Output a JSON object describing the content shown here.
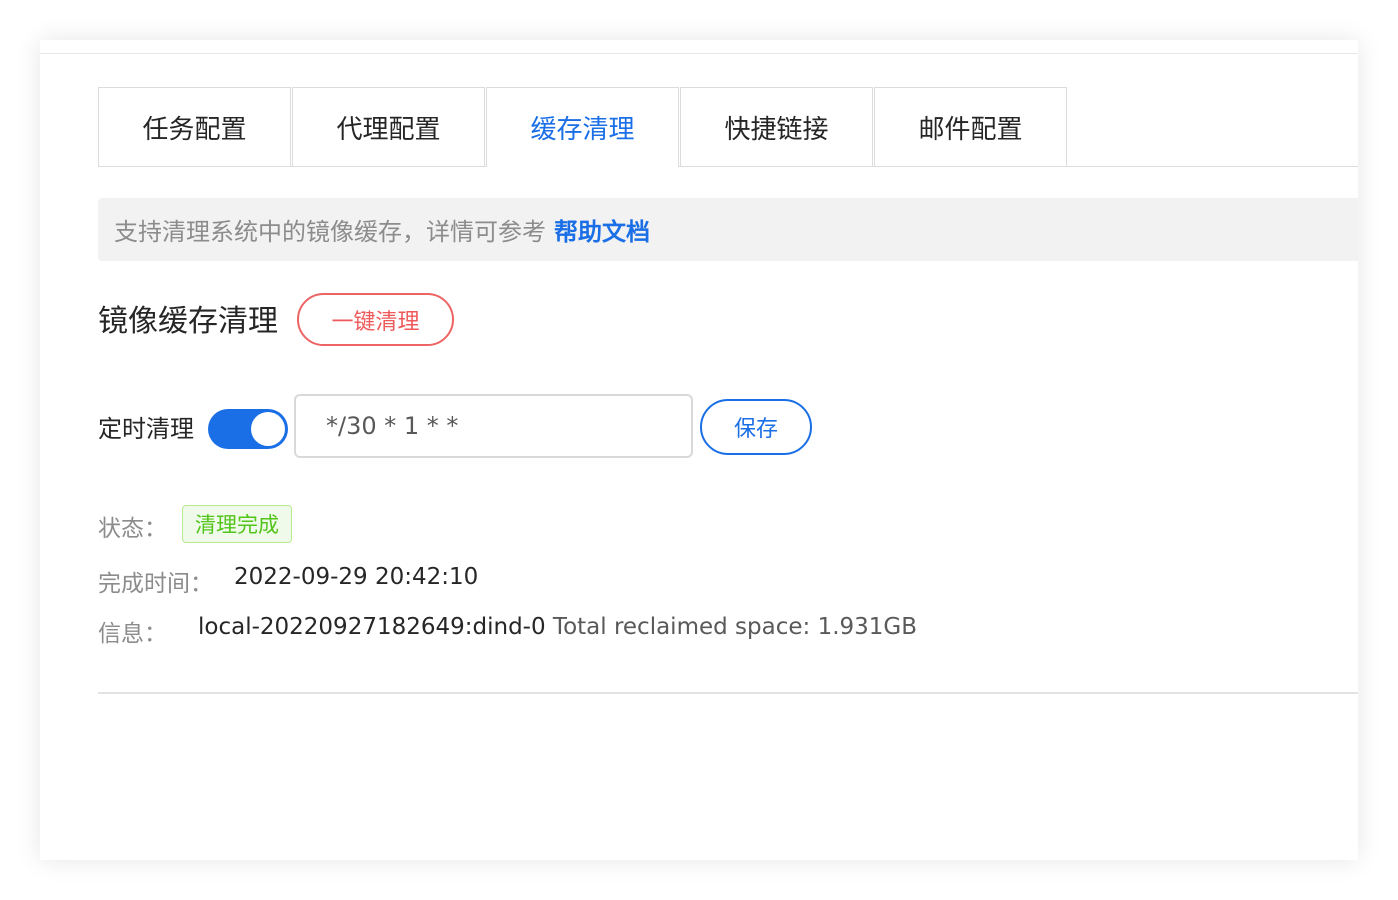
{
  "tabs": [
    {
      "label": "任务配置",
      "active": false
    },
    {
      "label": "代理配置",
      "active": false
    },
    {
      "label": "缓存清理",
      "active": true
    },
    {
      "label": "快捷链接",
      "active": false
    },
    {
      "label": "邮件配置",
      "active": false
    }
  ],
  "info": {
    "text": "支持清理系统中的镜像缓存，详情可参考",
    "link": "帮助文档"
  },
  "cache": {
    "title": "镜像缓存清理",
    "clean_button": "一键清理"
  },
  "schedule": {
    "label": "定时清理",
    "enabled": true,
    "cron_value": "*/30 * 1 * *",
    "save_button": "保存"
  },
  "status": {
    "status_label": "状态：",
    "status_value": "清理完成",
    "time_label": "完成时间：",
    "time_value": "2022-09-29 20:42:10",
    "info_label": "信息：",
    "info_value_main": "local-20220927182649:dind-0",
    "info_value_detail": "Total reclaimed space: 1.931GB"
  },
  "colors": {
    "primary": "#1a6fe6",
    "danger": "#ee5a5a",
    "success": "#52c41a"
  }
}
